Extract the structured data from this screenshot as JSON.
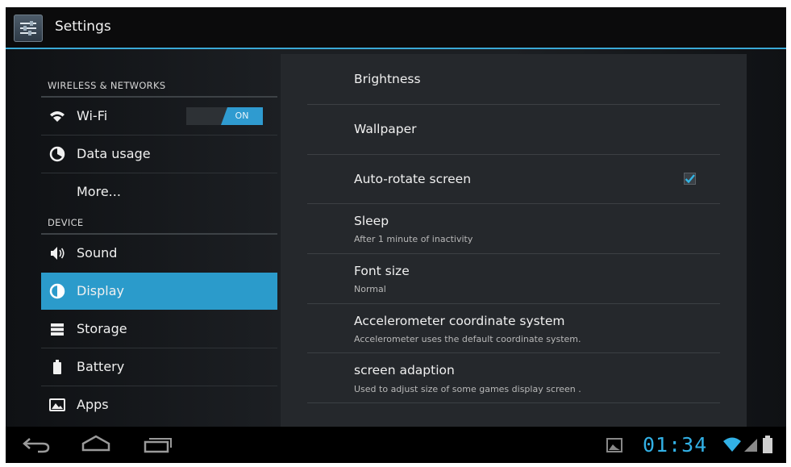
{
  "action_bar": {
    "title": "Settings"
  },
  "sidebar": {
    "sections": [
      {
        "header": "WIRELESS & NETWORKS",
        "items": [
          {
            "label": "Wi-Fi",
            "icon": "wifi-icon",
            "toggle": "ON"
          },
          {
            "label": "Data usage",
            "icon": "data-usage-icon"
          },
          {
            "label": "More..."
          }
        ]
      },
      {
        "header": "DEVICE",
        "items": [
          {
            "label": "Sound",
            "icon": "speaker-icon"
          },
          {
            "label": "Display",
            "icon": "display-icon",
            "selected": true
          },
          {
            "label": "Storage",
            "icon": "storage-icon"
          },
          {
            "label": "Battery",
            "icon": "battery-icon"
          },
          {
            "label": "Apps",
            "icon": "apps-icon"
          }
        ]
      }
    ]
  },
  "display_settings": [
    {
      "title": "Brightness"
    },
    {
      "title": "Wallpaper"
    },
    {
      "title": "Auto-rotate screen",
      "checked": true
    },
    {
      "title": "Sleep",
      "summary": "After 1 minute of inactivity"
    },
    {
      "title": "Font size",
      "summary": "Normal"
    },
    {
      "title": "Accelerometer coordinate system",
      "summary": "Accelerometer uses the default coordinate system."
    },
    {
      "title": "screen adaption",
      "summary": "Used to adjust size of some games display screen ."
    }
  ],
  "status_bar": {
    "time": "01:34"
  },
  "colors": {
    "accent": "#2b9bcb",
    "clock": "#32b1e6",
    "background": "#1c1f23"
  }
}
